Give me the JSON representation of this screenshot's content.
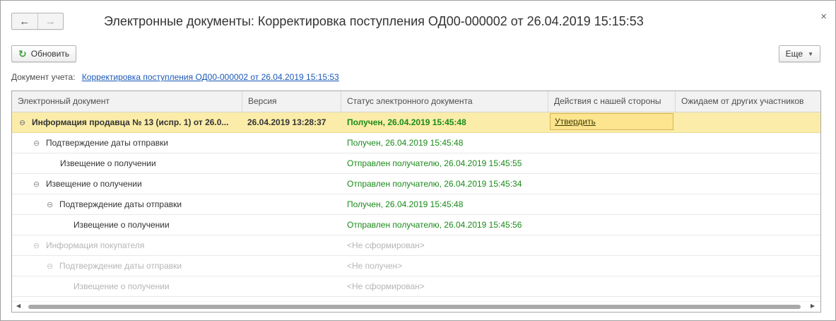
{
  "window": {
    "title": "Электронные документы: Корректировка поступления ОД00-000002 от 26.04.2019 15:15:53",
    "back_icon": "arrow-left-icon",
    "forward_icon": "arrow-right-icon",
    "close_icon": "close-icon"
  },
  "toolbar": {
    "refresh_label": "Обновить",
    "more_label": "Еще"
  },
  "doc_line": {
    "label": "Документ учета:",
    "link": "Корректировка поступления ОД00-000002 от 26.04.2019 15:15:53"
  },
  "grid": {
    "headers": {
      "name": "Электронный документ",
      "version": "Версия",
      "status": "Статус электронного документа",
      "actions": "Действия с нашей стороны",
      "waiting": "Ожидаем от других участников"
    },
    "rows": [
      {
        "name": "Информация продавца № 13 (испр. 1) от 26.0...",
        "version": "26.04.2019 13:28:37",
        "status": "Получен, 26.04.2019 15:45:48",
        "action": "Утвердить"
      },
      {
        "name": "Подтверждение даты отправки",
        "version": "",
        "status": "Получен, 26.04.2019 15:45:48",
        "action": ""
      },
      {
        "name": "Извещение о получении",
        "version": "",
        "status": "Отправлен получателю, 26.04.2019 15:45:55",
        "action": ""
      },
      {
        "name": "Извещение о получении",
        "version": "",
        "status": "Отправлен получателю, 26.04.2019 15:45:34",
        "action": ""
      },
      {
        "name": "Подтверждение даты отправки",
        "version": "",
        "status": "Получен, 26.04.2019 15:45:48",
        "action": ""
      },
      {
        "name": "Извещение о получении",
        "version": "",
        "status": "Отправлен получателю, 26.04.2019 15:45:56",
        "action": ""
      },
      {
        "name": "Информация покупателя",
        "version": "",
        "status": "<Не сформирован>",
        "action": ""
      },
      {
        "name": "Подтверждение даты отправки",
        "version": "",
        "status": "<Не получен>",
        "action": ""
      },
      {
        "name": "Извещение о получении",
        "version": "",
        "status": "<Не сформирован>",
        "action": ""
      }
    ]
  },
  "colors": {
    "selected_row": "#fbeda9",
    "status_ok": "#1a8a1a",
    "disabled_text": "#b5b5b5",
    "link": "#1b58b8"
  }
}
